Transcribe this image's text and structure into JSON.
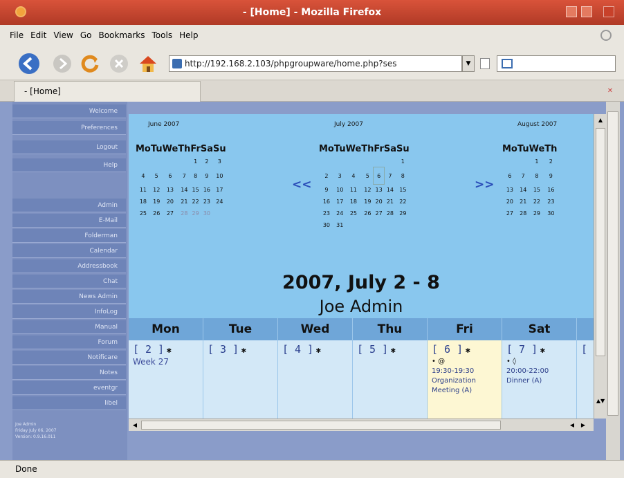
{
  "window": {
    "title": "- [Home] - Mozilla Firefox"
  },
  "menu": [
    "File",
    "Edit",
    "View",
    "Go",
    "Bookmarks",
    "Tools",
    "Help"
  ],
  "url": "http://192.168.2.103/phpgroupware/home.php?ses",
  "tab": {
    "label": "- [Home]"
  },
  "sidebar": {
    "items": [
      "Welcome",
      "Preferences",
      "Logout",
      "Help",
      "",
      "Admin",
      "E-Mail",
      "Folderman",
      "Calendar",
      "Addressbook",
      "Chat",
      "News Admin",
      "InfoLog",
      "Manual",
      "Forum",
      "Notificare",
      "Notes",
      "eventgr",
      "libel"
    ],
    "footer": [
      "Joe Admin",
      "Friday July 06, 2007",
      "Version: 0.9.16.011"
    ]
  },
  "calendar": {
    "weekdays": [
      "Mo",
      "Tu",
      "We",
      "Th",
      "Fr",
      "Sa",
      "Su"
    ],
    "prev": "<<",
    "next": ">>",
    "months": [
      {
        "title": "June 2007",
        "rows": [
          [
            "",
            "",
            "",
            "",
            "1",
            "2",
            "3"
          ],
          [
            "4",
            "5",
            "6",
            "7",
            "8",
            "9",
            "10"
          ],
          [
            "11",
            "12",
            "13",
            "14",
            "15",
            "16",
            "17"
          ],
          [
            "18",
            "19",
            "20",
            "21",
            "22",
            "23",
            "24"
          ],
          [
            "25",
            "26",
            "27",
            "28",
            "29",
            "30",
            ""
          ]
        ]
      },
      {
        "title": "July 2007",
        "today": "6",
        "rows": [
          [
            "",
            "",
            "",
            "",
            "",
            "",
            "1"
          ],
          [
            "2",
            "3",
            "4",
            "5",
            "6",
            "7",
            "8"
          ],
          [
            "9",
            "10",
            "11",
            "12",
            "13",
            "14",
            "15"
          ],
          [
            "16",
            "17",
            "18",
            "19",
            "20",
            "21",
            "22"
          ],
          [
            "23",
            "24",
            "25",
            "26",
            "27",
            "28",
            "29"
          ],
          [
            "30",
            "31",
            "",
            "",
            "",
            "",
            ""
          ]
        ]
      },
      {
        "title": "August 2007",
        "rows": [
          [
            "",
            "",
            "1",
            "2"
          ],
          [
            "6",
            "7",
            "8",
            "9"
          ],
          [
            "13",
            "14",
            "15",
            "16"
          ],
          [
            "20",
            "21",
            "22",
            "23"
          ],
          [
            "27",
            "28",
            "29",
            "30"
          ]
        ]
      }
    ],
    "week_title": "2007, July 2 - 8",
    "user": "Joe Admin",
    "days": [
      {
        "name": "Mon",
        "num": "[ 2 ]",
        "link": "Week 27"
      },
      {
        "name": "Tue",
        "num": "[ 3 ]"
      },
      {
        "name": "Wed",
        "num": "[ 4 ]"
      },
      {
        "name": "Thu",
        "num": "[ 5 ]"
      },
      {
        "name": "Fri",
        "num": "[ 6 ]",
        "time": "19:30-19:30",
        "event": "Organization Meeting (A)"
      },
      {
        "name": "Sat",
        "num": "[ 7 ]",
        "time": "20:00-22:00",
        "event": "Dinner (A)"
      }
    ],
    "next_day_num": "["
  },
  "status": "Done"
}
